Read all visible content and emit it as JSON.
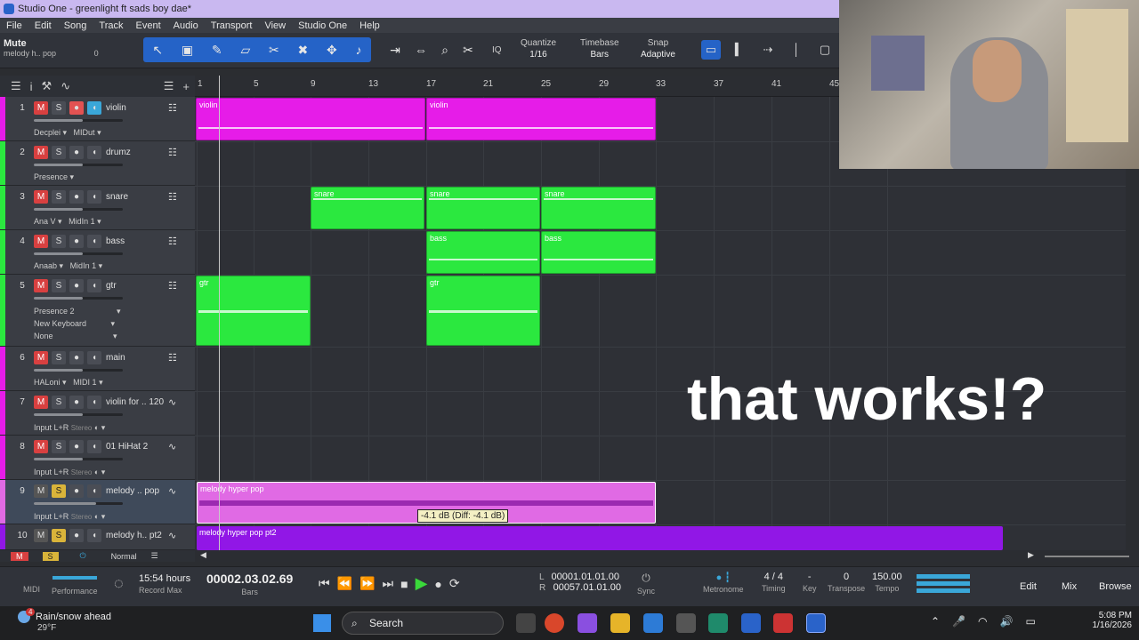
{
  "titlebar": {
    "title": "Studio One - greenlight ft sads boy dae*"
  },
  "menubar": {
    "items": [
      "File",
      "Edit",
      "Song",
      "Track",
      "Event",
      "Audio",
      "Transport",
      "View",
      "Studio One",
      "Help"
    ]
  },
  "toolbar": {
    "mute_label": "Mute",
    "mute_sub": "melody h.. pop",
    "mute_value": "0",
    "quantize_label": "Quantize",
    "quantize_value": "1/16",
    "timebase_label": "Timebase",
    "timebase_value": "Bars",
    "snap_label": "Snap",
    "snap_value": "Adaptive",
    "iq_label": "IQ"
  },
  "ruler": {
    "bars": [
      "1",
      "5",
      "9",
      "13",
      "17",
      "21",
      "25",
      "29",
      "33",
      "37",
      "41",
      "45"
    ]
  },
  "tracks": [
    {
      "num": "1",
      "name": "violin",
      "sub1": "Decplei",
      "sub2": "MIDut",
      "color": "#e61ce8"
    },
    {
      "num": "2",
      "name": "drumz",
      "sub1": "Presence",
      "color": "#2be83f"
    },
    {
      "num": "3",
      "name": "snare",
      "sub1": "Ana V",
      "sub2": "MidIn 1",
      "color": "#2be83f"
    },
    {
      "num": "4",
      "name": "bass",
      "sub1": "Anaab",
      "sub2": "MidIn 1",
      "color": "#2be83f"
    },
    {
      "num": "5",
      "name": "gtr",
      "sub1": "Presence 2",
      "sub2": "New Keyboard",
      "sub3": "None",
      "color": "#2be83f"
    },
    {
      "num": "6",
      "name": "main",
      "sub1": "HALoni",
      "sub2": "MIDI 1",
      "color": "#e61ce8"
    },
    {
      "num": "7",
      "name": "violin for .. 120",
      "sub1": "Input L+R",
      "stereo": "Stereo",
      "color": "#e61ce8"
    },
    {
      "num": "8",
      "name": "01 HiHat 2",
      "sub1": "Input L+R",
      "stereo": "Stereo",
      "color": "#e61ce8"
    },
    {
      "num": "9",
      "name": "melody .. pop",
      "sub1": "Input L+R",
      "stereo": "Stereo",
      "color": "#e06ae4"
    },
    {
      "num": "10",
      "name": "melody h.. pt2",
      "color": "#9117e6"
    }
  ],
  "clips": {
    "violin": "violin",
    "snare": "snare",
    "bass": "bass",
    "gtr": "gtr",
    "melody1": "melody hyper pop",
    "melody2": "melody hyper pop pt2"
  },
  "tooltip": "-4.1 dB (Diff: -4.1 dB)",
  "overlay": "that works!?",
  "footer": {
    "mode": "Normal"
  },
  "transport": {
    "midi_label": "MIDI",
    "performance_label": "Performance",
    "record_time": "15:54 hours",
    "record_max_label": "Record Max",
    "position": "00002.03.02.69",
    "position_unit": "Bars",
    "loop_l": "00001.01.01.00",
    "loop_r": "00057.01.01.00",
    "l_label": "L",
    "r_label": "R",
    "sync_label": "Sync",
    "metronome_label": "Metronome",
    "timing_value": "4 / 4",
    "timing_label": "Timing",
    "key_value": "-",
    "key_label": "Key",
    "transpose_value": "0",
    "transpose_label": "Transpose",
    "tempo_value": "150.00",
    "tempo_label": "Tempo",
    "edit_label": "Edit",
    "mix_label": "Mix",
    "browse_label": "Browse"
  },
  "taskbar": {
    "weather_title": "Rain/snow ahead",
    "weather_temp": "29°F",
    "weather_badge": "4",
    "search_label": "Search",
    "time": "5:08 PM",
    "date": "1/16/2026"
  },
  "colors": {
    "accent": "#2563c7",
    "green_clip": "#2be83f",
    "magenta_clip": "#e61ce8",
    "purple_clip": "#9117e6"
  }
}
